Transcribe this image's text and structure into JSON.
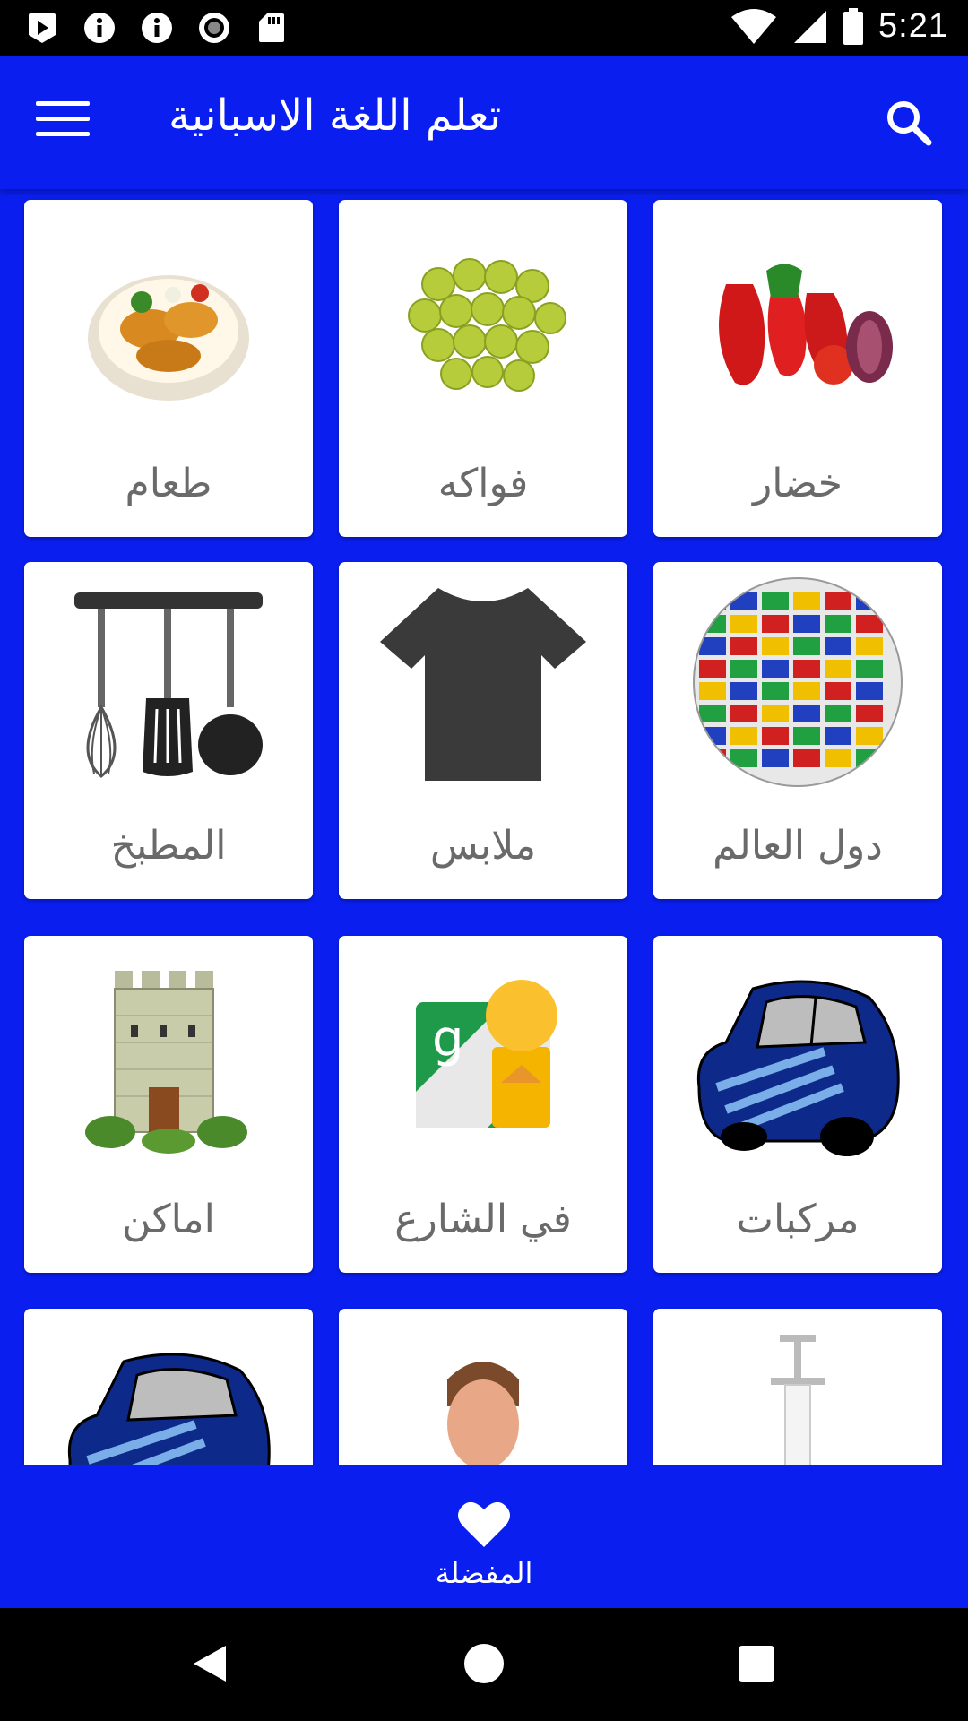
{
  "status_bar": {
    "time": "5:21",
    "left_icons": [
      "play-store-icon",
      "info-icon",
      "info-icon",
      "record-icon",
      "sd-card-icon"
    ],
    "right_icons": [
      "wifi-icon",
      "signal-icon",
      "battery-icon"
    ]
  },
  "app_bar": {
    "title": "تعلم اللغة الاسبانية",
    "menu_icon": "menu-icon",
    "search_icon": "search-icon"
  },
  "categories": [
    {
      "label": "طعام",
      "icon": "food-plate-image"
    },
    {
      "label": "فواكه",
      "icon": "grapes-image"
    },
    {
      "label": "خضار",
      "icon": "vegetables-image"
    },
    {
      "label": "المطبخ",
      "icon": "kitchen-utensils-image"
    },
    {
      "label": "ملابس",
      "icon": "tshirt-image"
    },
    {
      "label": "دول العالم",
      "icon": "flags-globe-image"
    },
    {
      "label": "اماكن",
      "icon": "castle-tower-image"
    },
    {
      "label": "في الشارع",
      "icon": "street-view-image"
    },
    {
      "label": "مركبات",
      "icon": "car-image"
    },
    {
      "label": "",
      "icon": "car-image"
    },
    {
      "label": "",
      "icon": "doctor-image"
    },
    {
      "label": "",
      "icon": "syringe-image"
    }
  ],
  "bottom_nav": {
    "favorites_label": "المفضلة",
    "favorites_icon": "heart-icon"
  },
  "colors": {
    "primary": "#0A1FEF",
    "card": "#FFFFFF",
    "label_text": "#6A6A6A"
  }
}
